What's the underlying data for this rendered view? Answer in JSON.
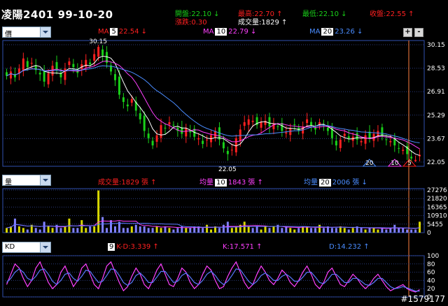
{
  "header": {
    "title": "凌陽2401 99-10-20",
    "open": "開盤:22.10 ↓",
    "high": "最高:22.70 ↑",
    "low": "最低:22.10 ↓",
    "close": "收盤:22.55 ↑",
    "change": "漲跌:0.30",
    "volume": "成交量:1829 ↑"
  },
  "price_panel": {
    "selector_value": "價",
    "ma1_label": "MA",
    "ma1_period": "5",
    "ma1_value": "22.54 ↓",
    "ma2_label": "MA",
    "ma2_period": "10",
    "ma2_value": "22.79 ↓",
    "ma3_label": "MA",
    "ma3_period": "20",
    "ma3_value": "23.26 ↓",
    "zoom_in": "+",
    "zoom_out": "-",
    "y_ticks": [
      "30.15",
      "28.53",
      "26.91",
      "25.29",
      "23.67",
      "22.05"
    ],
    "high_marker": "30.15",
    "low_marker": "22.05",
    "ma_markers": [
      "20",
      "10",
      "5"
    ]
  },
  "volume_panel": {
    "selector_value": "量",
    "vol_text": "成交量:1829 張 ↑",
    "avg1_label": "均量",
    "avg1_period": "10",
    "avg1_value": "1843 張 ↑",
    "avg2_label": "均量",
    "avg2_period": "20",
    "avg2_value": "2006 張 ↓",
    "y_ticks": [
      "27276",
      "21820",
      "16365",
      "10910",
      "5455",
      "0"
    ]
  },
  "kd_panel": {
    "selector_value": "KD",
    "period": "9",
    "kd_diff": "K-D:3.339 ↑",
    "k_value": "K:17.571 ↑",
    "d_value": "D:14.232 ↑",
    "y_ticks": [
      "100",
      "80",
      "60",
      "40",
      "20",
      "0"
    ]
  },
  "watermark": "#1579177",
  "colors": {
    "up": "#ff2020",
    "down": "#19d019",
    "k_line": "#ff40ff",
    "d_line": "#5a78ff",
    "ma5": "#ffffff",
    "ma10": "#ff40ff",
    "ma20": "#4a8cff",
    "volume": "#d8d800",
    "grid": "#2a3a7a"
  },
  "chart_data": [
    {
      "type": "candlestick",
      "title": "凌陽2401",
      "y_range": [
        22.05,
        30.15
      ],
      "ticks": [
        30.15,
        28.53,
        26.91,
        25.29,
        23.67,
        22.05
      ],
      "series_count": 100,
      "close_path": [
        28.0,
        28.3,
        27.9,
        28.5,
        29.2,
        28.6,
        28.9,
        28.4,
        28.1,
        27.6,
        28.2,
        28.7,
        28.4,
        27.9,
        28.5,
        29.0,
        28.6,
        28.2,
        28.8,
        29.1,
        28.8,
        29.5,
        30.0,
        29.4,
        28.9,
        28.3,
        27.7,
        26.7,
        26.2,
        25.9,
        26.4,
        25.6,
        25.0,
        24.2,
        23.7,
        23.2,
        23.9,
        24.6,
        24.4,
        24.8,
        24.6,
        24.2,
        24.0,
        24.4,
        24.1,
        23.8,
        23.7,
        23.3,
        23.6,
        23.9,
        24.2,
        23.6,
        23.0,
        22.6,
        22.9,
        23.7,
        24.3,
        24.8,
        25.0,
        24.9,
        24.6,
        24.8,
        24.9,
        24.5,
        24.7,
        24.5,
        24.2,
        24.1,
        24.4,
        24.6,
        24.2,
        24.5,
        25.0,
        24.6,
        24.3,
        24.8,
        24.6,
        24.2,
        23.7,
        23.2,
        23.6,
        24.0,
        23.7,
        23.8,
        23.6,
        23.5,
        23.9,
        23.7,
        24.0,
        24.2,
        23.8,
        23.6,
        23.5,
        23.2,
        23.0,
        22.9,
        22.6,
        22.3,
        22.2,
        22.55
      ]
    },
    {
      "type": "bar",
      "title": "量",
      "y_range": [
        0,
        27276
      ],
      "volume_path": [
        3,
        4,
        9,
        4,
        3,
        2,
        5,
        3,
        2,
        7,
        4,
        3,
        5,
        3,
        4,
        9,
        3,
        3,
        8,
        3,
        4,
        4,
        27,
        10,
        3,
        8,
        4,
        7,
        3,
        3,
        4,
        5,
        4,
        4,
        3,
        3,
        4,
        3,
        4,
        3,
        2,
        3,
        4,
        3,
        3,
        4,
        4,
        3,
        5,
        2,
        4,
        3,
        5,
        7,
        3,
        4,
        5,
        7,
        4,
        3,
        4,
        2,
        4,
        3,
        4,
        5,
        3,
        4,
        3,
        2,
        3,
        4,
        4,
        3,
        3,
        5,
        3,
        4,
        3,
        3,
        4,
        3,
        2,
        3,
        4,
        3,
        2,
        3,
        3,
        2,
        3,
        2,
        3,
        5,
        3,
        3,
        2,
        2,
        2,
        7
      ]
    },
    {
      "type": "line",
      "title": "KD",
      "y_range": [
        0,
        100
      ],
      "series": [
        {
          "name": "K",
          "values": [
            30,
            55,
            80,
            70,
            45,
            25,
            40,
            70,
            85,
            60,
            35,
            20,
            30,
            60,
            75,
            50,
            25,
            40,
            70,
            80,
            55,
            30,
            20,
            45,
            75,
            85,
            60,
            35,
            15,
            25,
            50,
            70,
            55,
            30,
            20,
            40,
            65,
            80,
            55,
            30,
            25,
            45,
            70,
            60,
            35,
            20,
            30,
            55,
            75,
            65,
            40,
            20,
            25,
            50,
            70,
            85,
            60,
            35,
            20,
            30,
            55,
            75,
            60,
            40,
            30,
            45,
            65,
            55,
            35,
            25,
            40,
            60,
            75,
            55,
            30,
            20,
            35,
            60,
            70,
            50,
            30,
            25,
            40,
            55,
            45,
            30,
            20,
            30,
            45,
            55,
            40,
            25,
            15,
            20,
            25,
            30,
            20,
            15,
            12,
            17.571
          ]
        },
        {
          "name": "D",
          "values": [
            35,
            45,
            60,
            68,
            60,
            45,
            40,
            50,
            65,
            68,
            55,
            38,
            30,
            40,
            55,
            58,
            45,
            38,
            50,
            65,
            62,
            48,
            35,
            38,
            52,
            68,
            66,
            52,
            35,
            28,
            35,
            52,
            58,
            48,
            35,
            35,
            48,
            62,
            62,
            48,
            35,
            38,
            52,
            58,
            48,
            35,
            30,
            40,
            55,
            62,
            52,
            38,
            30,
            38,
            52,
            68,
            66,
            52,
            38,
            30,
            38,
            52,
            58,
            50,
            40,
            40,
            50,
            55,
            48,
            38,
            38,
            48,
            60,
            60,
            48,
            35,
            32,
            42,
            55,
            55,
            45,
            35,
            35,
            45,
            45,
            38,
            30,
            28,
            35,
            45,
            45,
            35,
            25,
            20,
            22,
            25,
            22,
            18,
            14,
            14.232
          ]
        }
      ]
    }
  ]
}
